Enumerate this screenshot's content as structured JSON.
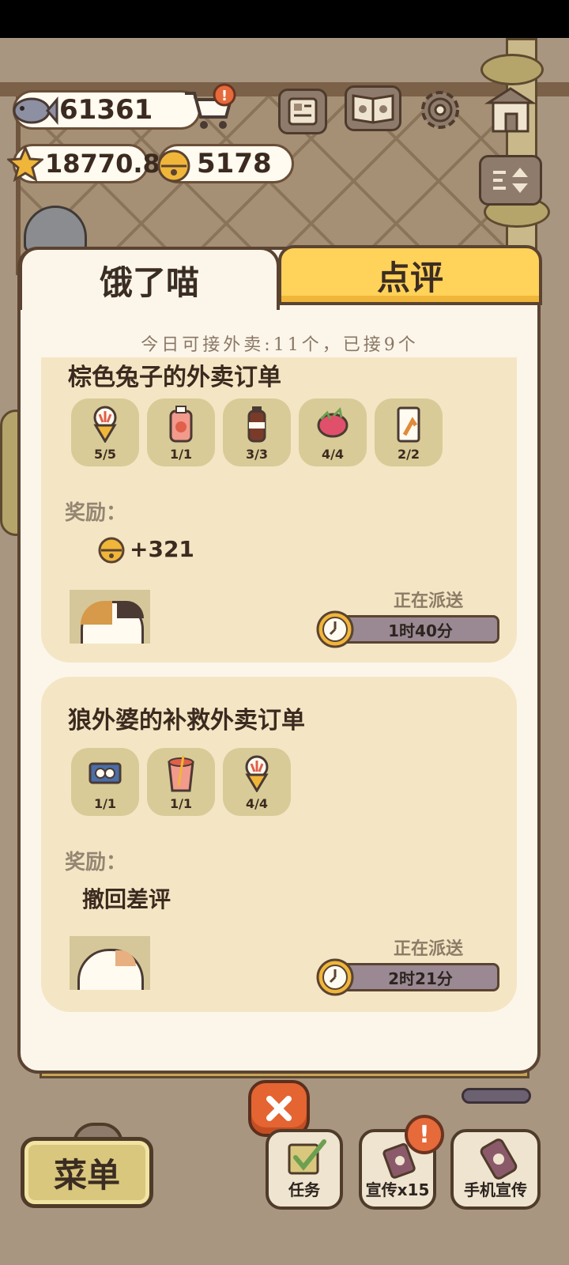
{
  "currency": {
    "fish": "61361",
    "stars": "18770.8",
    "bells": "5178"
  },
  "tabs": {
    "active": "饿了喵",
    "inactive": "点评"
  },
  "quota_text": "今日可接外卖:11个，已接9个",
  "orders": [
    {
      "title": "棕色兔子的外卖订单",
      "items": [
        {
          "icon": "ice-cream-cone-icon",
          "count": "5/5"
        },
        {
          "icon": "strawberry-drink-icon",
          "count": "1/1"
        },
        {
          "icon": "cola-bottle-icon",
          "count": "3/3"
        },
        {
          "icon": "dragon-fruit-icon",
          "count": "4/4"
        },
        {
          "icon": "fries-bag-icon",
          "count": "2/2"
        }
      ],
      "reward_label": "奖励：",
      "reward_value": "+321",
      "status": "正在派送",
      "timer": "1时40分",
      "progress": 0.04
    },
    {
      "title": "狼外婆的补救外卖订单",
      "items": [
        {
          "icon": "sushi-tray-icon",
          "count": "1/1"
        },
        {
          "icon": "fruit-cup-icon",
          "count": "1/1"
        },
        {
          "icon": "ice-cream-cone-icon",
          "count": "4/4"
        }
      ],
      "reward_label": "奖励：",
      "reward_value": "撤回差评",
      "status": "正在派送",
      "timer": "2时21分",
      "progress": 0.0
    }
  ],
  "bottom": {
    "menu": "菜单",
    "tasks": "任务",
    "promo": "宣传x15",
    "phone_promo": "手机宣传",
    "alert": "!"
  },
  "colors": {
    "tab_active": "#fcf6ea",
    "tab_inactive": "#ffd25a",
    "card": "#f4e6c4",
    "close_button": "#e46432"
  }
}
